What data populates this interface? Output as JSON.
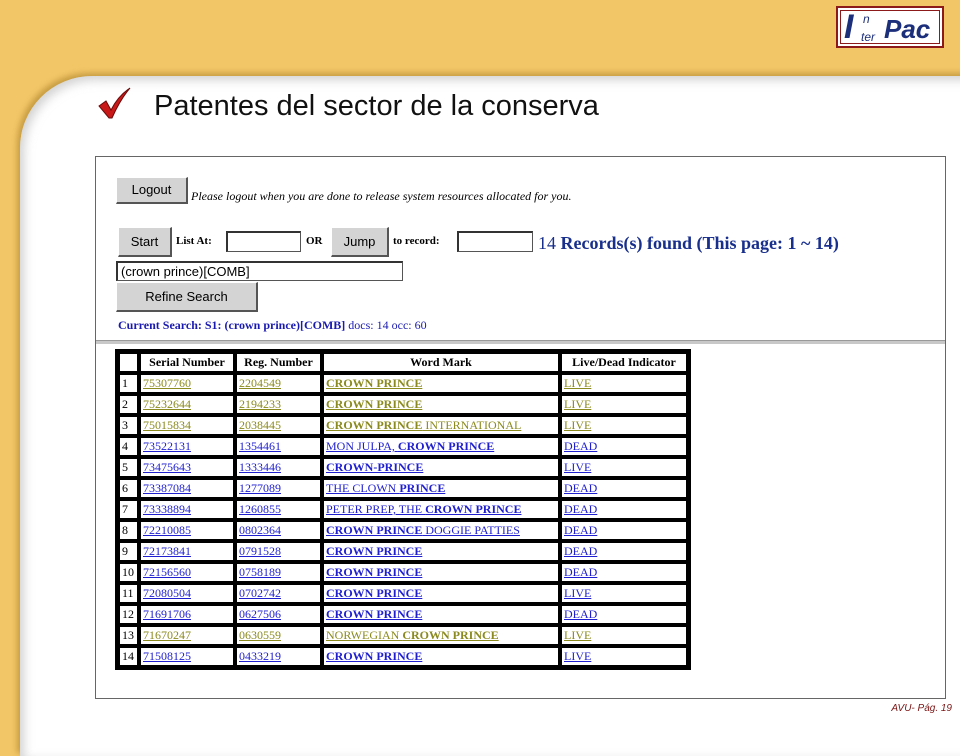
{
  "slide": {
    "title": "Patentes del sector de la conserva",
    "footer": "AVU- Pág. 19",
    "logo": {
      "i": "I",
      "n": "n",
      "ter": "ter",
      "pac": "Pac"
    }
  },
  "colors": {
    "background": "#f2c666",
    "visited_link": "#8a8a1e",
    "link": "#1f1fd0",
    "heading_blue": "#182f8c"
  },
  "search_page": {
    "logout_label": "Logout",
    "logout_message": "Please logout when you are done to release system resources allocated for you.",
    "start_label": "Start",
    "list_at_label": "List At:",
    "list_at_value": "",
    "or_label": "OR",
    "jump_label": "Jump",
    "to_record_label": "to record:",
    "to_record_value": "",
    "records_count": "14",
    "records_text": "Records(s) found (This page: 1 ~ 14)",
    "query_value": "(crown prince)[COMB]",
    "refine_label": "Refine Search",
    "current_search_label": "Current Search: S1: (crown prince)[COMB]",
    "current_search_stats": "docs: 14 occ: 60",
    "table": {
      "headers": [
        "",
        "Serial Number",
        "Reg. Number",
        "Word Mark",
        "Live/Dead Indicator"
      ],
      "rows": [
        {
          "n": "1",
          "serial": "75307760",
          "reg": "2204549",
          "pre": "",
          "mark": "CROWN PRINCE",
          "post": "",
          "status": "LIVE",
          "visited": true
        },
        {
          "n": "2",
          "serial": "75232644",
          "reg": "2194233",
          "pre": "",
          "mark": "CROWN PRINCE",
          "post": "",
          "status": "LIVE",
          "visited": true
        },
        {
          "n": "3",
          "serial": "75015834",
          "reg": "2038445",
          "pre": "",
          "mark": "CROWN PRINCE",
          "post": " INTERNATIONAL",
          "status": "LIVE",
          "visited": true
        },
        {
          "n": "4",
          "serial": "73522131",
          "reg": "1354461",
          "pre": "MON JULPA, ",
          "mark": "CROWN PRINCE",
          "post": "",
          "status": "DEAD",
          "visited": false
        },
        {
          "n": "5",
          "serial": "73475643",
          "reg": "1333446",
          "pre": "",
          "mark": "CROWN-PRINCE",
          "post": "",
          "status": "LIVE",
          "visited": false
        },
        {
          "n": "6",
          "serial": "73387084",
          "reg": "1277089",
          "pre": "THE CLOWN ",
          "mark": "PRINCE",
          "post": "",
          "status": "DEAD",
          "visited": false
        },
        {
          "n": "7",
          "serial": "73338894",
          "reg": "1260855",
          "pre": "PETER PREP, THE ",
          "mark": "CROWN PRINCE",
          "post": "",
          "status": "DEAD",
          "visited": false
        },
        {
          "n": "8",
          "serial": "72210085",
          "reg": "0802364",
          "pre": "",
          "mark": "CROWN PRINCE",
          "post": " DOGGIE PATTIES",
          "status": "DEAD",
          "visited": false
        },
        {
          "n": "9",
          "serial": "72173841",
          "reg": "0791528",
          "pre": "",
          "mark": "CROWN PRINCE",
          "post": "",
          "status": "DEAD",
          "visited": false
        },
        {
          "n": "10",
          "serial": "72156560",
          "reg": "0758189",
          "pre": "",
          "mark": "CROWN PRINCE",
          "post": "",
          "status": "DEAD",
          "visited": false
        },
        {
          "n": "11",
          "serial": "72080504",
          "reg": "0702742",
          "pre": "",
          "mark": "CROWN PRINCE",
          "post": "",
          "status": "LIVE",
          "visited": false
        },
        {
          "n": "12",
          "serial": "71691706",
          "reg": "0627506",
          "pre": "",
          "mark": "CROWN PRINCE",
          "post": "",
          "status": "DEAD",
          "visited": false
        },
        {
          "n": "13",
          "serial": "71670247",
          "reg": "0630559",
          "pre": "NORWEGIAN ",
          "mark": "CROWN PRINCE",
          "post": "",
          "status": "LIVE",
          "visited": true
        },
        {
          "n": "14",
          "serial": "71508125",
          "reg": "0433219",
          "pre": "",
          "mark": "CROWN PRINCE",
          "post": "",
          "status": "LIVE",
          "visited": false
        }
      ]
    }
  }
}
